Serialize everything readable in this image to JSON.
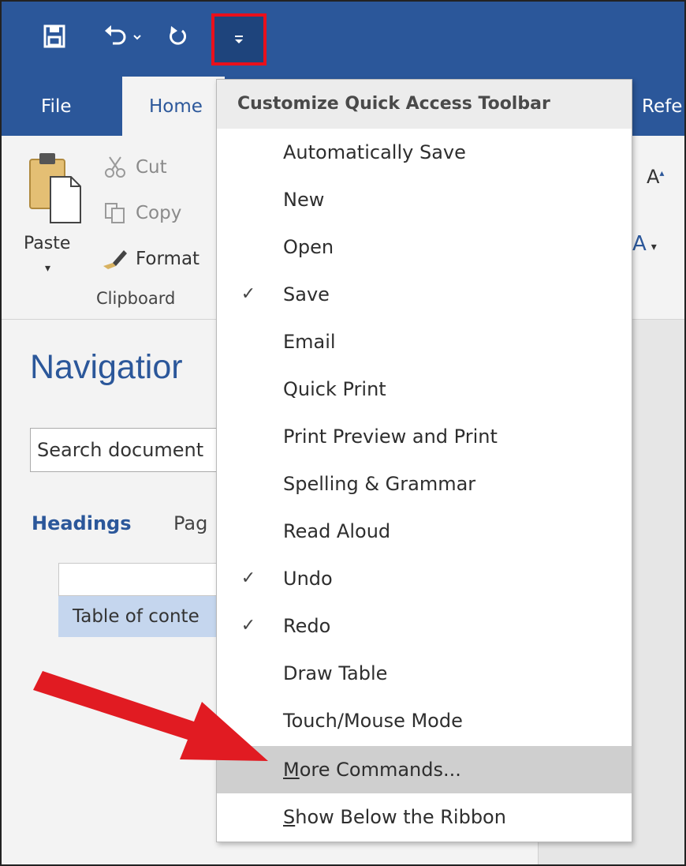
{
  "qat": {
    "save_icon": "save-icon",
    "undo_icon": "undo-icon",
    "undo_dropdown_icon": "chevron-down-icon",
    "redo_icon": "redo-icon",
    "customize_icon": "customize-dropdown-icon"
  },
  "tabs": {
    "file": "File",
    "home": "Home",
    "references_partial": "Refe"
  },
  "ribbon": {
    "paste_label": "Paste",
    "cut_label": "Cut",
    "copy_label": "Copy",
    "format_label": "Format",
    "group_clipboard": "Clipboard",
    "grow_font_icon": "grow-font-icon",
    "text_effects_icon": "text-effects-icon"
  },
  "navigation": {
    "title": "Navigatior",
    "search_value": "Search document",
    "tab_headings": "Headings",
    "tab_pages_partial": "Pag",
    "heading_toc": "Table of conte"
  },
  "menu": {
    "header": "Customize Quick Access Toolbar",
    "items": [
      {
        "label": "Automatically Save",
        "checked": false
      },
      {
        "label": "New",
        "checked": false
      },
      {
        "label": "Open",
        "checked": false
      },
      {
        "label": "Save",
        "checked": true
      },
      {
        "label": "Email",
        "checked": false
      },
      {
        "label": "Quick Print",
        "checked": false
      },
      {
        "label": "Print Preview and Print",
        "checked": false
      },
      {
        "label": "Spelling & Grammar",
        "checked": false
      },
      {
        "label": "Read Aloud",
        "checked": false
      },
      {
        "label": "Undo",
        "checked": true
      },
      {
        "label": "Redo",
        "checked": true
      },
      {
        "label": "Draw Table",
        "checked": false
      },
      {
        "label": "Touch/Mouse Mode",
        "checked": false
      }
    ],
    "more_commands": {
      "label_first": "M",
      "label_rest": "ore Commands..."
    },
    "show_below": {
      "label_first": "S",
      "label_rest": "how Below the Ribbon"
    },
    "check_glyph": "✓"
  },
  "colors": {
    "title_bar": "#2b579a",
    "highlight_box": "#e8101c",
    "annotation_arrow": "#e11b22",
    "menu_hover": "#cfcfcf"
  }
}
